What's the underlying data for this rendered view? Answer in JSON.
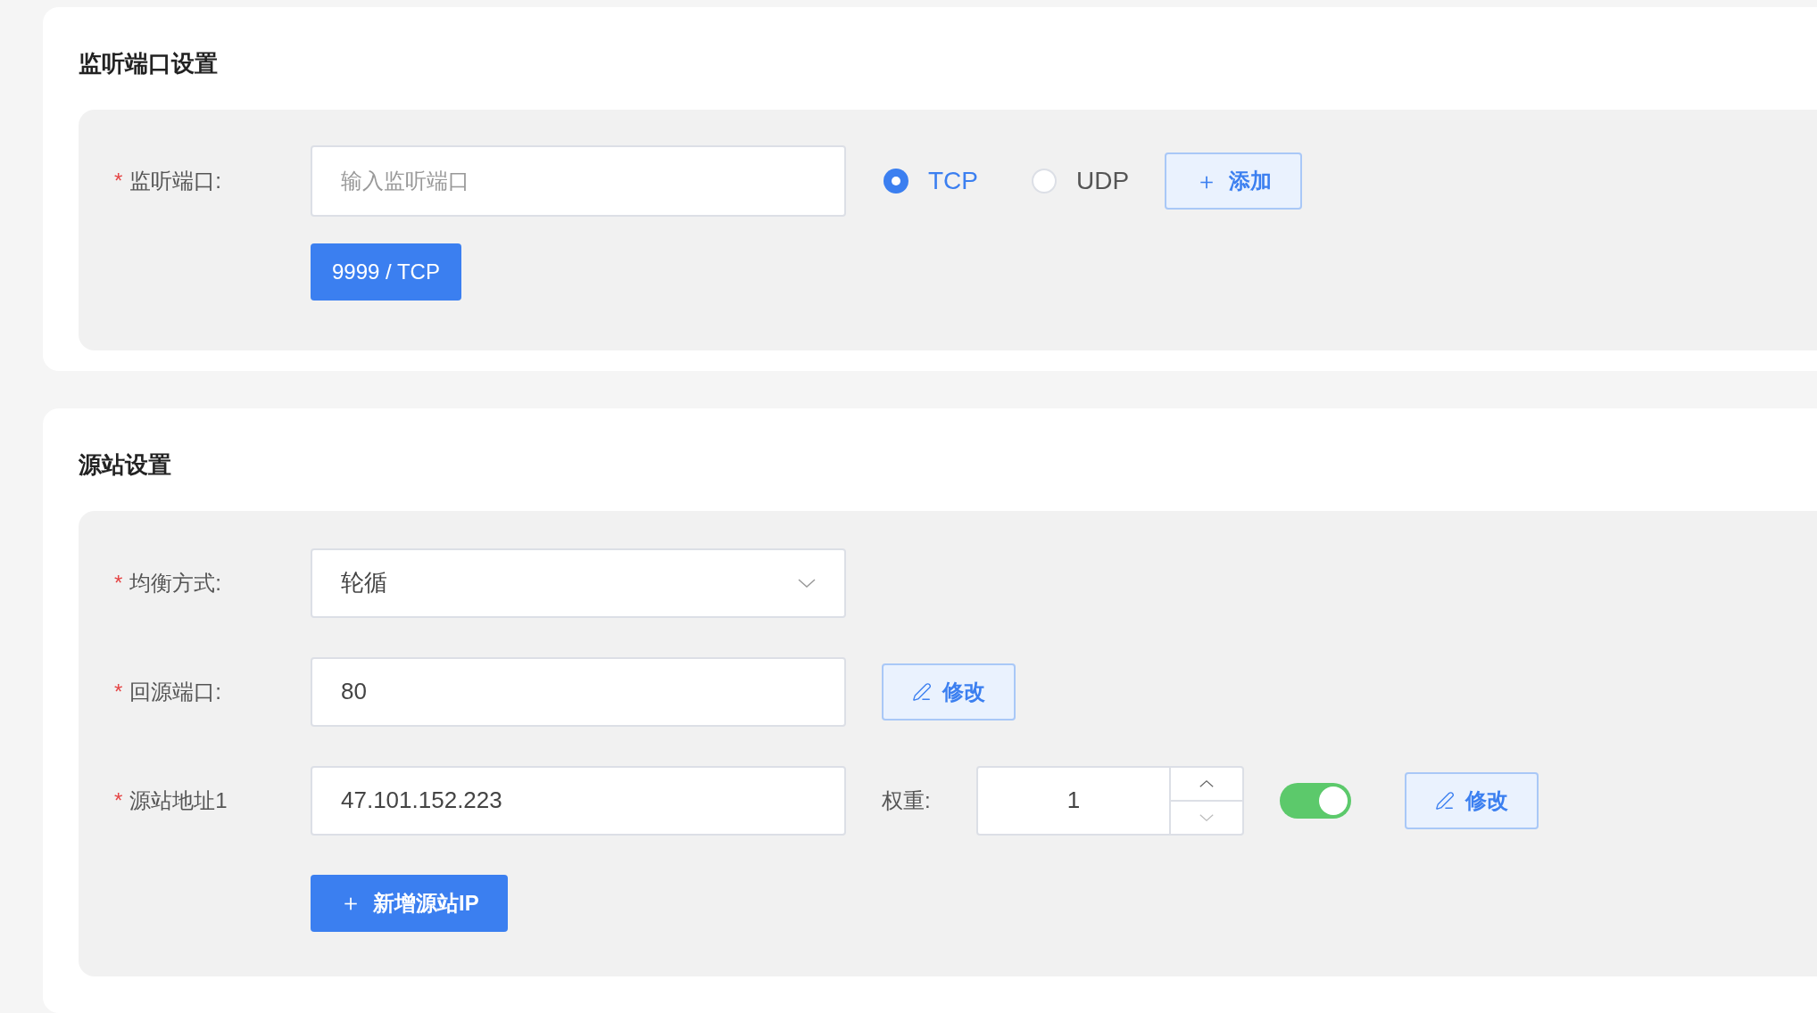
{
  "listen_section": {
    "title": "监听端口设置",
    "port_field": {
      "required_mark": "*",
      "label": "监听端口:",
      "placeholder": "输入监听端口"
    },
    "protocols": [
      {
        "label": "TCP",
        "selected": true
      },
      {
        "label": "UDP",
        "selected": false
      }
    ],
    "add_button": {
      "icon": "＋",
      "label": "添加"
    },
    "ports": [
      "9999 / TCP"
    ]
  },
  "origin_section": {
    "title": "源站设置",
    "balance": {
      "required_mark": "*",
      "label": "均衡方式:",
      "value": "轮循"
    },
    "back_port": {
      "required_mark": "*",
      "label": "回源端口:",
      "value": "80",
      "button": "修改"
    },
    "origins": [
      {
        "required_mark": "*",
        "label": "源站地址1",
        "value": "47.101.152.223",
        "weight_label": "权重:",
        "weight": "1",
        "on": true,
        "button": "修改"
      }
    ],
    "add_origin_button": {
      "icon": "＋",
      "label": "新增源站IP"
    }
  }
}
